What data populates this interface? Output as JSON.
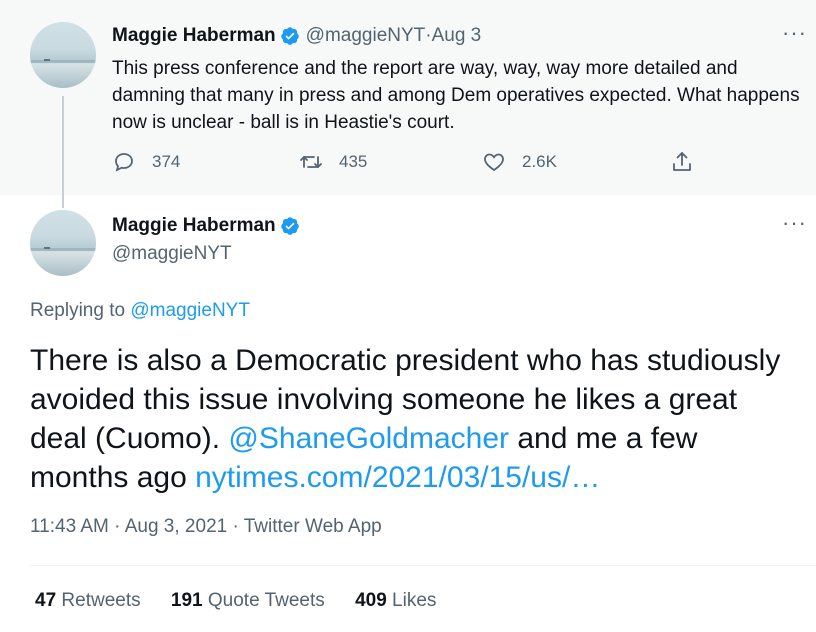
{
  "parent_tweet": {
    "author_name": "Maggie Haberman",
    "handle": "@maggieNYT",
    "separator": " · ",
    "date": "Aug 3",
    "more_label": "···",
    "text": "This press conference and the report are way, way, way more detailed and damning that many in press and among Dem operatives expected. What happens now is unclear - ball is in Heastie's court.",
    "replies": "374",
    "retweets": "435",
    "likes": "2.6K"
  },
  "main_tweet": {
    "author_name": "Maggie Haberman",
    "handle": "@maggieNYT",
    "more_label": "···",
    "replying_prefix": "Replying to ",
    "replying_handle": "@maggieNYT",
    "text_part1": "There is also a Democratic president who has studiously avoided this issue involving someone he likes a great deal (Cuomo). ",
    "mention": "@ShaneGoldmacher",
    "text_part2": " and me a few months ago ",
    "link": "nytimes.com/2021/03/15/us/…",
    "time": "11:43 AM",
    "date": "Aug 3, 2021",
    "source": "Twitter Web App",
    "meta_separator": " · ",
    "stats": {
      "retweets_count": "47",
      "retweets_label": " Retweets",
      "quote_count": "191",
      "quote_label": " Quote Tweets",
      "likes_count": "409",
      "likes_label": " Likes"
    }
  },
  "colors": {
    "link": "#1d9bf0",
    "verified": "#1d9bf0",
    "secondary_text": "#536471",
    "parent_bg": "#f7f9f9"
  },
  "icons": [
    "verified-badge-icon",
    "reply-icon",
    "retweet-icon",
    "like-icon",
    "share-icon",
    "more-icon"
  ]
}
